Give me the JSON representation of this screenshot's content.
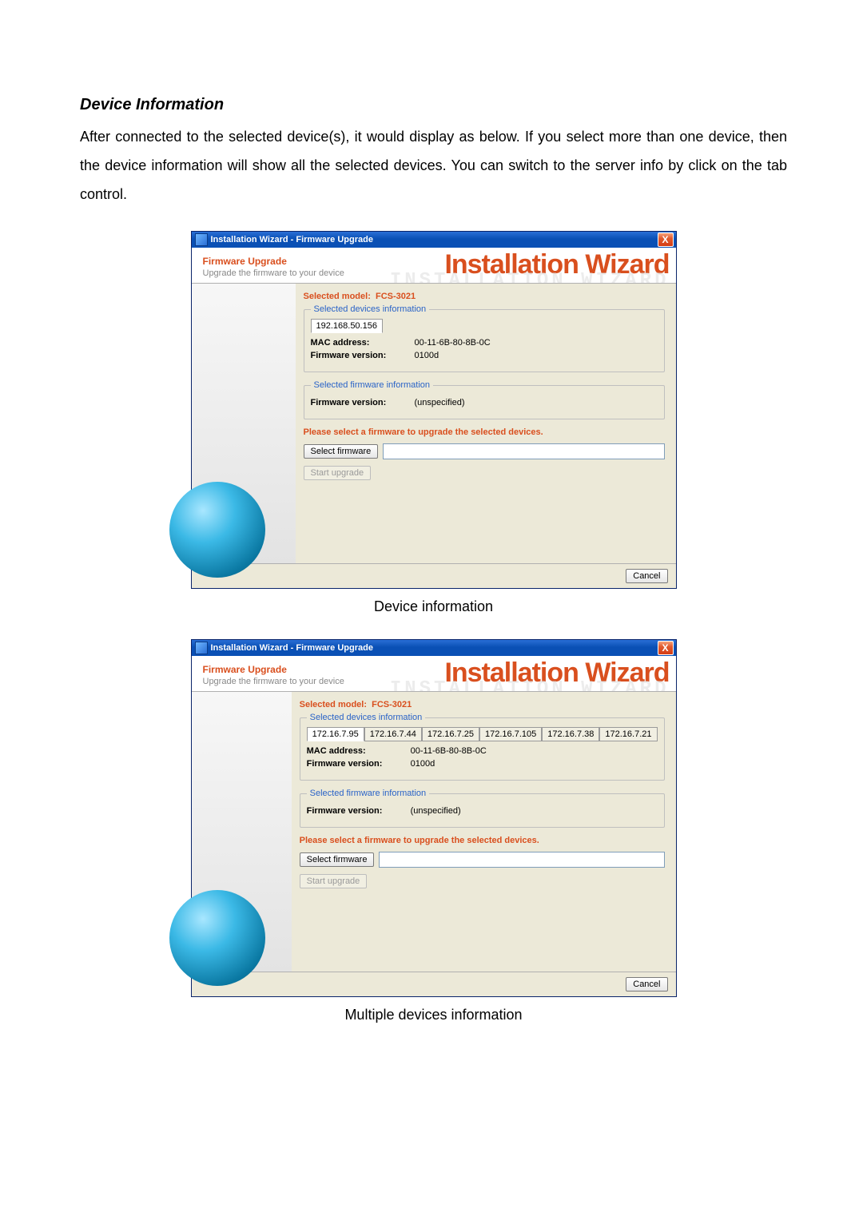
{
  "section": {
    "title": "Device Information",
    "paragraph": "After connected to the selected device(s), it would display as below. If you select more than one device, then the device information will show all the selected devices. You can switch to the server info by click on the tab control.",
    "caption1": "Device information",
    "caption2": "Multiple devices information"
  },
  "common": {
    "window_title": "Installation Wizard - Firmware Upgrade",
    "close_glyph": "X",
    "header_title": "Firmware Upgrade",
    "header_sub": "Upgrade the firmware to your device",
    "wizard_brand": "Installation Wizard",
    "model_label": "Selected model:",
    "model_value": "FCS-3021",
    "group_devices": "Selected devices information",
    "group_firmware": "Selected firmware information",
    "mac_label": "MAC address:",
    "fwver_label": "Firmware version:",
    "current_fwver": "0100d",
    "selected_fwver": "(unspecified)",
    "select_prompt": "Please select a firmware to upgrade the selected devices.",
    "select_btn": "Select firmware",
    "start_btn": "Start upgrade",
    "cancel_btn": "Cancel",
    "mac_value": "00-11-6B-80-8B-0C"
  },
  "dialog1": {
    "tabs": [
      "192.168.50.156"
    ]
  },
  "dialog2": {
    "tabs": [
      "172.16.7.95",
      "172.16.7.44",
      "172.16.7.25",
      "172.16.7.105",
      "172.16.7.38",
      "172.16.7.21"
    ]
  }
}
